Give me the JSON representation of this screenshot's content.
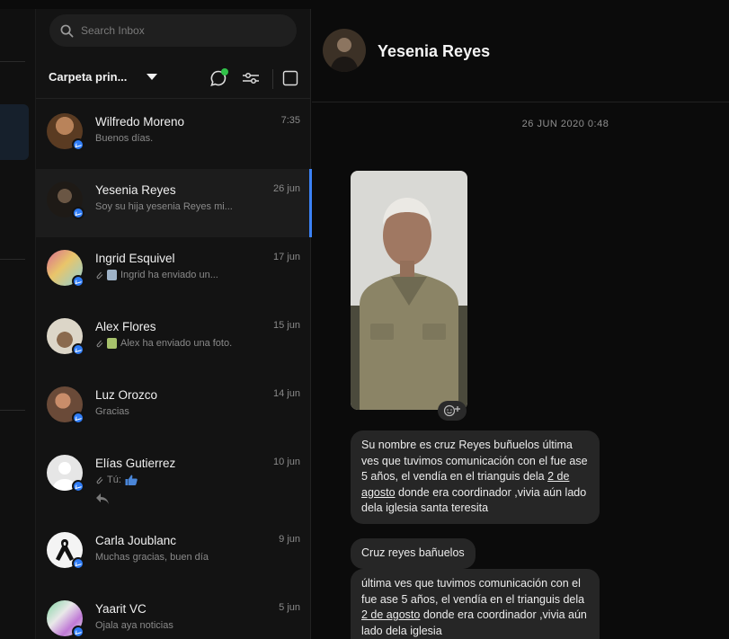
{
  "search": {
    "placeholder": "Search Inbox"
  },
  "toolbar": {
    "folder_label": "Carpeta prin..."
  },
  "conversations": [
    {
      "name": "Wilfredo Moreno",
      "preview": "Buenos días.",
      "date": "7:35"
    },
    {
      "name": "Yesenia Reyes",
      "preview": "Soy su hija yesenia Reyes mi...",
      "date": "26 jun"
    },
    {
      "name": "Ingrid Esquivel",
      "preview": "Ingrid ha enviado un...",
      "date": "17 jun"
    },
    {
      "name": "Alex Flores",
      "preview": "Alex ha enviado una foto.",
      "date": "15 jun"
    },
    {
      "name": "Luz Orozco",
      "preview": "Gracias",
      "date": "14 jun"
    },
    {
      "name": "Elías Gutierrez",
      "preview": "Tú:",
      "date": "10 jun"
    },
    {
      "name": "Carla Joublanc",
      "preview": "Muchas gracias, buen día",
      "date": "9 jun"
    },
    {
      "name": "Yaarit VC",
      "preview": "Ojala aya noticias",
      "date": "5 jun"
    }
  ],
  "chat": {
    "title": "Yesenia Reyes",
    "timestamp": "26 JUN 2020 0:48",
    "messages": [
      {
        "pre": "Su nombre es cruz Reyes buñuelos última ves que tuvimos comunicación con el fue ase 5 años,  el vendía en el trianguis dela ",
        "link": "2 de agosto",
        "post": " donde era coordinador ,vivia aún lado dela iglesia santa teresita"
      },
      {
        "text": "Cruz reyes bañuelos"
      },
      {
        "pre": "última ves que tuvimos comunicación con el fue ase 5 años,  el vendía en el trianguis dela ",
        "link": "2 de agosto",
        "post": " donde era coordinador ,vivia aún lado dela iglesia"
      }
    ]
  },
  "colors": {
    "accent": "#3b82f6",
    "online": "#31c24a",
    "badge": "#2f7cf6",
    "bubble": "#262626"
  }
}
